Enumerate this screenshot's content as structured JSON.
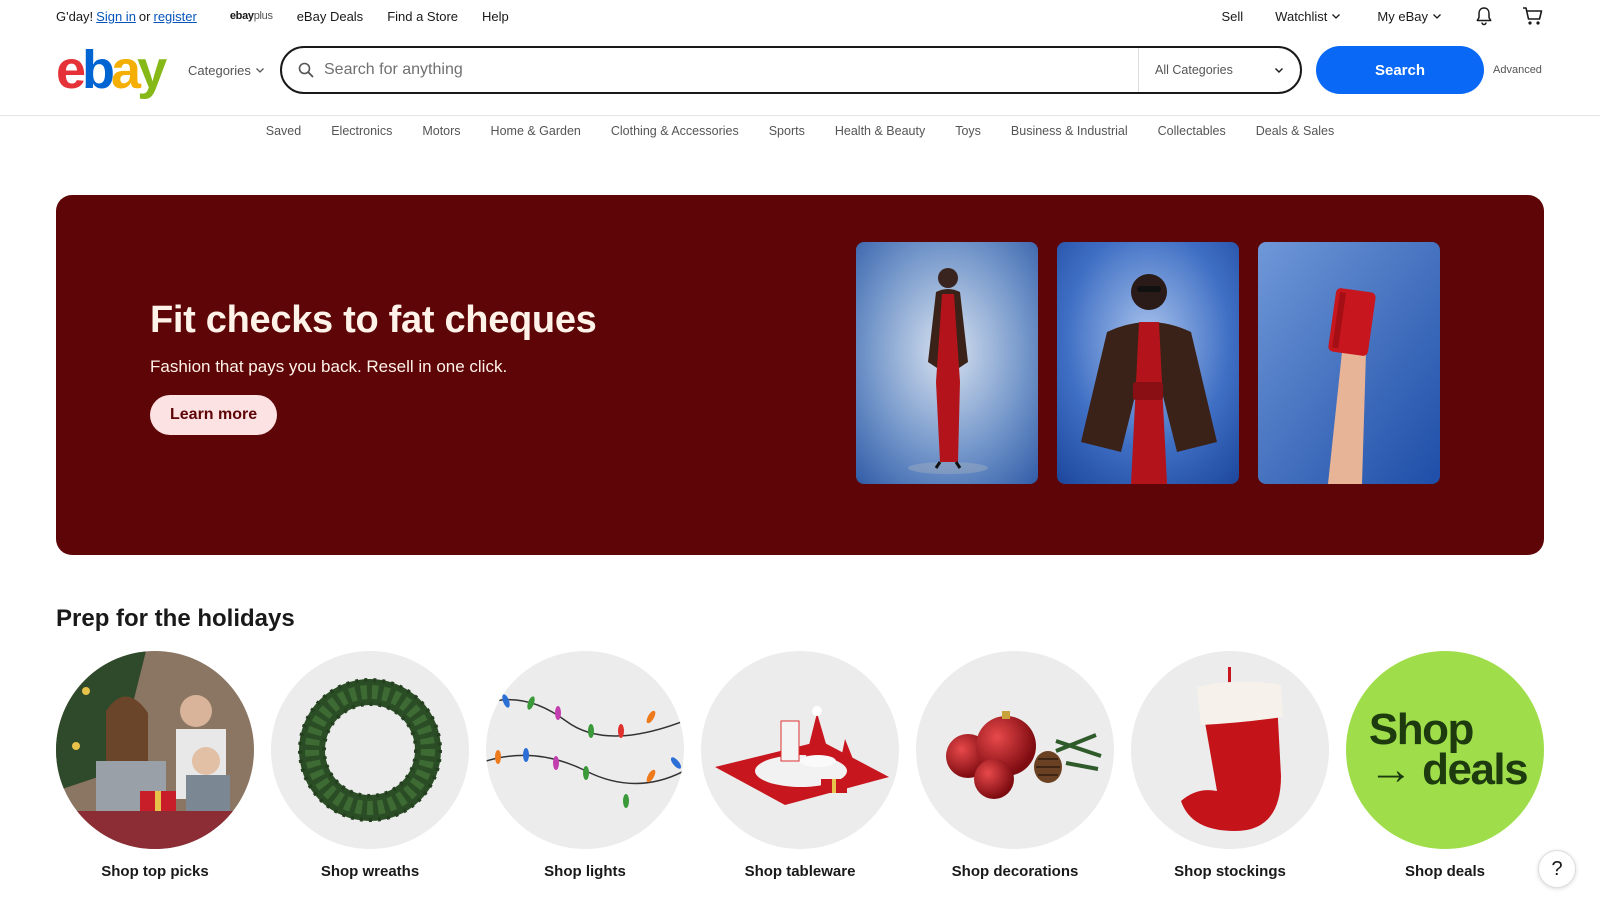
{
  "topbar": {
    "greeting": "G'day!",
    "sign_in": "Sign in",
    "or": "or",
    "register": "register",
    "ebayplus_brand": "ebay",
    "ebayplus_suffix": "plus",
    "links": [
      "eBay Deals",
      "Find a Store",
      "Help"
    ],
    "sell": "Sell",
    "watchlist": "Watchlist",
    "my_ebay": "My eBay"
  },
  "header": {
    "logo_letters": [
      "e",
      "b",
      "a",
      "y"
    ],
    "logo_colors": [
      "#e53238",
      "#0064d2",
      "#f5af02",
      "#86b817"
    ],
    "categories_label": "Categories",
    "search_placeholder": "Search for anything",
    "category_select": "All Categories",
    "search_button": "Search",
    "advanced": "Advanced"
  },
  "catnav": [
    "Saved",
    "Electronics",
    "Motors",
    "Home & Garden",
    "Clothing & Accessories",
    "Sports",
    "Health & Beauty",
    "Toys",
    "Business & Industrial",
    "Collectables",
    "Deals & Sales"
  ],
  "hero": {
    "title": "Fit checks to fat cheques",
    "subtitle": "Fashion that pays you back. Resell in one click.",
    "cta": "Learn more",
    "bg_color": "#5d0507"
  },
  "holidays": {
    "title": "Prep for the holidays",
    "items": [
      {
        "label": "Shop top picks"
      },
      {
        "label": "Shop wreaths"
      },
      {
        "label": "Shop lights"
      },
      {
        "label": "Shop tableware"
      },
      {
        "label": "Shop decorations"
      },
      {
        "label": "Shop stockings"
      },
      {
        "label": "Shop deals",
        "art_line1": "Shop",
        "art_line2": "→ deals"
      }
    ]
  },
  "help_button": "?"
}
